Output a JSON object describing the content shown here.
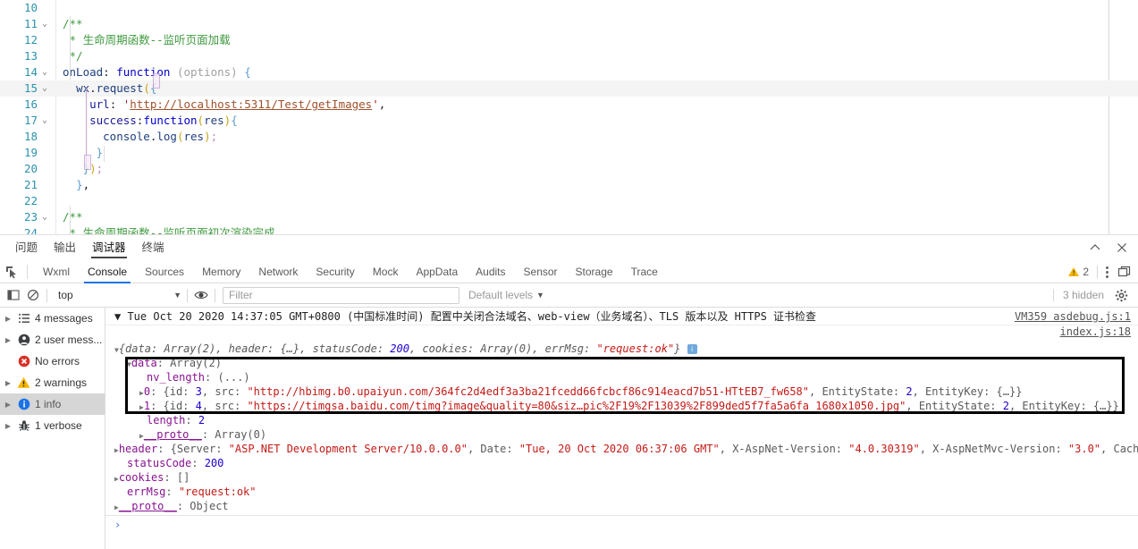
{
  "editor": {
    "lines": [
      {
        "num": "10",
        "fold": "",
        "segs": []
      },
      {
        "num": "11",
        "fold": "⌄",
        "segs": [
          {
            "c": "t-com",
            "t": "/**"
          }
        ]
      },
      {
        "num": "12",
        "fold": "",
        "segs": [
          {
            "c": "t-com",
            "t": " * 生命周期函数--监听页面加载"
          }
        ]
      },
      {
        "num": "13",
        "fold": "",
        "segs": [
          {
            "c": "t-com",
            "t": " */"
          }
        ]
      },
      {
        "num": "14",
        "fold": "⌄",
        "segs": [
          {
            "c": "t-id",
            "t": "onLoad"
          },
          {
            "c": "t-pl",
            "t": ": "
          },
          {
            "c": "t-key",
            "t": "function"
          },
          {
            "c": "t-pl",
            "t": " "
          },
          {
            "c": "t-par",
            "t": "(options)"
          },
          {
            "c": "t-pl",
            "t": " "
          },
          {
            "c": "t-brc",
            "t": "{"
          }
        ]
      },
      {
        "num": "15",
        "fold": "⌄",
        "segs": [
          {
            "c": "t-pl",
            "t": "  "
          },
          {
            "c": "t-id",
            "t": "wx"
          },
          {
            "c": "t-pl",
            "t": "."
          },
          {
            "c": "t-id",
            "t": "request"
          },
          {
            "c": "t-yel",
            "t": "("
          },
          {
            "c": "t-brc",
            "t": "{"
          }
        ]
      },
      {
        "num": "16",
        "fold": "",
        "segs": [
          {
            "c": "t-pl",
            "t": "    "
          },
          {
            "c": "t-prop",
            "t": "url"
          },
          {
            "c": "t-pl",
            "t": ": "
          },
          {
            "c": "t-str",
            "t": "'"
          },
          {
            "c": "t-link",
            "t": "http://localhost:5311/Test/getImages"
          },
          {
            "c": "t-str",
            "t": "'"
          },
          {
            "c": "t-pl",
            "t": ","
          }
        ]
      },
      {
        "num": "17",
        "fold": "⌄",
        "segs": [
          {
            "c": "t-pl",
            "t": "    "
          },
          {
            "c": "t-prop",
            "t": "success"
          },
          {
            "c": "t-pl",
            "t": ":"
          },
          {
            "c": "t-key",
            "t": "function"
          },
          {
            "c": "t-yel",
            "t": "("
          },
          {
            "c": "t-id",
            "t": "res"
          },
          {
            "c": "t-yel",
            "t": ")"
          },
          {
            "c": "t-brc",
            "t": "{"
          }
        ]
      },
      {
        "num": "18",
        "fold": "",
        "segs": [
          {
            "c": "t-pl",
            "t": "      "
          },
          {
            "c": "t-id",
            "t": "console"
          },
          {
            "c": "t-pl",
            "t": "."
          },
          {
            "c": "t-id",
            "t": "log"
          },
          {
            "c": "t-yel",
            "t": "("
          },
          {
            "c": "t-id",
            "t": "res"
          },
          {
            "c": "t-yel",
            "t": ")"
          },
          {
            "c": "t-pnk",
            "t": ";"
          }
        ]
      },
      {
        "num": "19",
        "fold": "",
        "segs": [
          {
            "c": "t-pl",
            "t": "     "
          },
          {
            "c": "t-brc",
            "t": "}"
          }
        ]
      },
      {
        "num": "20",
        "fold": "",
        "segs": [
          {
            "c": "t-pl",
            "t": "   "
          },
          {
            "c": "t-brc",
            "t": "}"
          },
          {
            "c": "t-yel",
            "t": ")"
          },
          {
            "c": "t-pnk",
            "t": ";"
          }
        ]
      },
      {
        "num": "21",
        "fold": "",
        "segs": [
          {
            "c": "t-pl",
            "t": "  "
          },
          {
            "c": "t-brc",
            "t": "}"
          },
          {
            "c": "t-pl",
            "t": ","
          }
        ]
      },
      {
        "num": "22",
        "fold": "",
        "segs": []
      },
      {
        "num": "23",
        "fold": "⌄",
        "segs": [
          {
            "c": "t-com",
            "t": "/**"
          }
        ]
      },
      {
        "num": "24",
        "fold": "",
        "segs": [
          {
            "c": "t-com",
            "t": " * 生命周期函数--监听页面初次渲染完成"
          }
        ]
      }
    ]
  },
  "panel_header": {
    "tabs": [
      {
        "label": "问题",
        "selected": false
      },
      {
        "label": "输出",
        "selected": false
      },
      {
        "label": "调试器",
        "selected": true
      },
      {
        "label": "终端",
        "selected": false
      }
    ],
    "minimize_icon": "chevron-up-icon",
    "close_icon": "close-icon"
  },
  "devtools": {
    "inspect_icon": "inspect-element-icon",
    "tabs": [
      {
        "label": "Wxml",
        "selected": false
      },
      {
        "label": "Console",
        "selected": true
      },
      {
        "label": "Sources",
        "selected": false
      },
      {
        "label": "Memory",
        "selected": false
      },
      {
        "label": "Network",
        "selected": false
      },
      {
        "label": "Security",
        "selected": false
      },
      {
        "label": "Mock",
        "selected": false
      },
      {
        "label": "AppData",
        "selected": false
      },
      {
        "label": "Audits",
        "selected": false
      },
      {
        "label": "Sensor",
        "selected": false
      },
      {
        "label": "Storage",
        "selected": false
      },
      {
        "label": "Trace",
        "selected": false
      }
    ],
    "warning_count": "2",
    "more_icon": "kebab-menu-icon",
    "dock_icon": "dock-panel-icon"
  },
  "filterbar": {
    "sidebar_toggle_icon": "console-sidebar-icon",
    "clear_icon": "clear-console-icon",
    "context": "top",
    "eye_icon": "live-expression-icon",
    "filter_placeholder": "Filter",
    "filter_value": "",
    "levels_label": "Default levels",
    "hidden_label": "3 hidden",
    "settings_icon": "gear-icon"
  },
  "sidebar": {
    "items": [
      {
        "label": "4 messages",
        "icon": "list-icon",
        "arrow": true,
        "selected": false
      },
      {
        "label": "2 user mess...",
        "icon": "user-icon",
        "arrow": true,
        "selected": false
      },
      {
        "label": "No errors",
        "icon": "error-icon",
        "arrow": false,
        "selected": false
      },
      {
        "label": "2 warnings",
        "icon": "warning-icon",
        "arrow": true,
        "selected": false
      },
      {
        "label": "1 info",
        "icon": "info-icon",
        "arrow": true,
        "selected": true
      },
      {
        "label": "1 verbose",
        "icon": "bug-icon",
        "arrow": true,
        "selected": false
      }
    ]
  },
  "console": {
    "warning_message": "▼ Tue Oct 20 2020 14:37:05 GMT+0800 (中国标准时间) 配置中关闭合法域名、web-view（业务域名）、TLS 版本以及 HTTPS 证书检查",
    "warning_source": "VM359 asdebug.js:1",
    "object_source": "index.js:18",
    "prompt_symbol": "›",
    "object_lines": [
      {
        "indent": 10,
        "segs": [
          {
            "c": "arw",
            "t": "▼"
          },
          {
            "c": "v-ital",
            "t": "{data: Array(2), header: {…}, statusCode: "
          },
          {
            "c": "v-ital-n",
            "t": "200"
          },
          {
            "c": "v-ital",
            "t": ", cookies: Array(0), errMsg: "
          },
          {
            "c": "v-ital-s",
            "t": "\"request:ok\""
          },
          {
            "c": "v-ital",
            "t": "}"
          },
          {
            "c": "pad",
            "t": " "
          },
          {
            "c": "chip",
            "t": "i"
          }
        ]
      },
      {
        "indent": 24,
        "segs": [
          {
            "c": "arw",
            "t": "▼"
          },
          {
            "c": "k-purple",
            "t": "data"
          },
          {
            "c": "k-grey",
            "t": ": Array(2)"
          }
        ]
      },
      {
        "indent": 46,
        "segs": [
          {
            "c": "k-purple",
            "t": "nv_length"
          },
          {
            "c": "k-grey",
            "t": ": (...)"
          }
        ]
      },
      {
        "indent": 38,
        "segs": [
          {
            "c": "arw",
            "t": "▶"
          },
          {
            "c": "k-purple",
            "t": "0"
          },
          {
            "c": "k-grey",
            "t": ": {id: "
          },
          {
            "c": "v-num",
            "t": "3"
          },
          {
            "c": "k-grey",
            "t": ", src: "
          },
          {
            "c": "v-str",
            "t": "\"http://hbimg.b0.upaiyun.com/364fc2d4edf3a3ba21fcedd66fcbcf86c914eacd7b51-HTtEB7_fw658\""
          },
          {
            "c": "k-grey",
            "t": ", EntityState: "
          },
          {
            "c": "v-num",
            "t": "2"
          },
          {
            "c": "k-grey",
            "t": ", EntityKey: {…}}"
          }
        ]
      },
      {
        "indent": 38,
        "segs": [
          {
            "c": "arw",
            "t": "▶"
          },
          {
            "c": "k-purple",
            "t": "1"
          },
          {
            "c": "k-grey",
            "t": ": {id: "
          },
          {
            "c": "v-num",
            "t": "4"
          },
          {
            "c": "k-grey",
            "t": ", src: "
          },
          {
            "c": "v-str",
            "t": "\"https://timgsa.baidu.com/timg?image&quality=80&siz…pic%2F19%2F13039%2F899ded5f7fa5a6fa_1680x1050.jpg\""
          },
          {
            "c": "k-grey",
            "t": ", EntityState: "
          },
          {
            "c": "v-num",
            "t": "2"
          },
          {
            "c": "k-grey",
            "t": ", EntityKey: {…}}"
          }
        ]
      },
      {
        "indent": 46,
        "segs": [
          {
            "c": "k-purple",
            "t": "length"
          },
          {
            "c": "k-grey",
            "t": ": "
          },
          {
            "c": "v-num",
            "t": "2"
          }
        ]
      },
      {
        "indent": 38,
        "segs": [
          {
            "c": "arw",
            "t": "▶"
          },
          {
            "c": "proto",
            "t": "__proto__"
          },
          {
            "c": "k-grey",
            "t": ": Array(0)"
          }
        ]
      },
      {
        "indent": 10,
        "segs": [
          {
            "c": "arw",
            "t": "▶"
          },
          {
            "c": "k-purple",
            "t": "header"
          },
          {
            "c": "k-grey",
            "t": ": {Server: "
          },
          {
            "c": "v-str",
            "t": "\"ASP.NET Development Server/10.0.0.0\""
          },
          {
            "c": "k-grey",
            "t": ", Date: "
          },
          {
            "c": "v-str",
            "t": "\"Tue, 20 Oct 2020 06:37:06 GMT\""
          },
          {
            "c": "k-grey",
            "t": ", X-AspNet-Version: "
          },
          {
            "c": "v-str",
            "t": "\"4.0.30319\""
          },
          {
            "c": "k-grey",
            "t": ", X-AspNetMvc-Version: "
          },
          {
            "c": "v-str",
            "t": "\"3.0\""
          },
          {
            "c": "k-grey",
            "t": ", Cache-Con…"
          }
        ]
      },
      {
        "indent": 24,
        "segs": [
          {
            "c": "k-purple",
            "t": "statusCode"
          },
          {
            "c": "k-grey",
            "t": ": "
          },
          {
            "c": "v-num",
            "t": "200"
          }
        ]
      },
      {
        "indent": 10,
        "segs": [
          {
            "c": "arw",
            "t": "▶"
          },
          {
            "c": "k-purple",
            "t": "cookies"
          },
          {
            "c": "k-grey",
            "t": ": []"
          }
        ]
      },
      {
        "indent": 24,
        "segs": [
          {
            "c": "k-purple",
            "t": "errMsg"
          },
          {
            "c": "k-grey",
            "t": ": "
          },
          {
            "c": "v-str",
            "t": "\"request:ok\""
          }
        ]
      },
      {
        "indent": 10,
        "segs": [
          {
            "c": "arw",
            "t": "▶"
          },
          {
            "c": "proto",
            "t": "__proto__"
          },
          {
            "c": "k-grey",
            "t": ": Object"
          }
        ]
      }
    ]
  },
  "colors": {
    "accent": "#1a73e8",
    "warning": "#f5b400",
    "error": "#d93025",
    "info": "#1a73e8",
    "string": "#c41a16",
    "number": "#1c00cf",
    "key": "#881391",
    "highlight_box": "#000000"
  }
}
